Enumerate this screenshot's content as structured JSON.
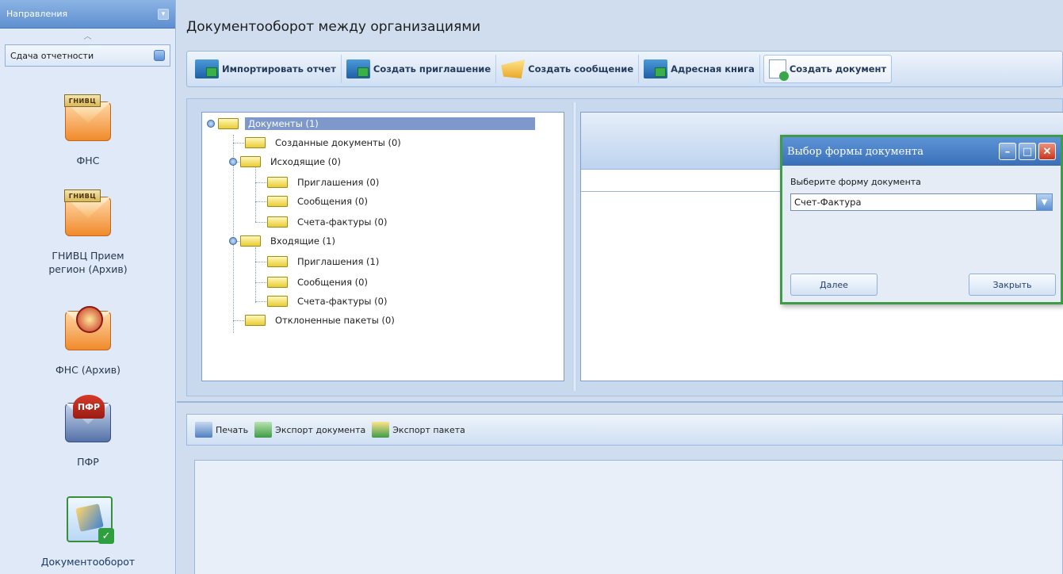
{
  "left_panel": {
    "header": "Направления",
    "section_button": "Сдача отчетности",
    "items": [
      {
        "label": "ФНС",
        "tag": "ГНИВЦ"
      },
      {
        "label": "ГНИВЦ Прием регион (Архив)",
        "tag": "ГНИВЦ"
      },
      {
        "label": "ФНС (Архив)"
      },
      {
        "label": "ПФР",
        "tag": "ПФР"
      },
      {
        "label": "Документооборот"
      }
    ]
  },
  "main": {
    "title": "Документооборот между организациями",
    "toolbar": [
      {
        "label": "Импортировать отчет",
        "icon": "import-icon"
      },
      {
        "label": "Создать приглашение",
        "icon": "invite-icon"
      },
      {
        "label": "Создать сообщение",
        "icon": "message-icon"
      },
      {
        "label": "Адресная книга",
        "icon": "address-book-icon"
      },
      {
        "label": "Создать документ",
        "icon": "create-document-icon"
      }
    ],
    "tree": [
      {
        "label": "Документы (1)",
        "level": 0,
        "selected": true
      },
      {
        "label": "Созданные документы (0)",
        "level": 1
      },
      {
        "label": "Исходящие (0)",
        "level": 1
      },
      {
        "label": "Приглашения (0)",
        "level": 2
      },
      {
        "label": "Сообщения (0)",
        "level": 2
      },
      {
        "label": "Счета-фактуры (0)",
        "level": 2
      },
      {
        "label": "Входящие (1)",
        "level": 1
      },
      {
        "label": "Приглашения (1)",
        "level": 2
      },
      {
        "label": "Сообщения (0)",
        "level": 2
      },
      {
        "label": "Счета-фактуры (0)",
        "level": 2
      },
      {
        "label": "Отклоненные пакеты (0)",
        "level": 1
      }
    ]
  },
  "dialog": {
    "title": "Выбор формы документа",
    "prompt": "Выберите форму документа",
    "selected_value": "Счет-Фактура",
    "next_button": "Далее",
    "close_button": "Закрыть"
  },
  "bottom_toolbar": {
    "print": "Печать",
    "export_document": "Экспорт документа",
    "export_package": "Экспорт пакета"
  },
  "colors": {
    "accent": "#5e8fcf",
    "selection": "#7e98cc",
    "dialog_border": "#3e9b47"
  }
}
